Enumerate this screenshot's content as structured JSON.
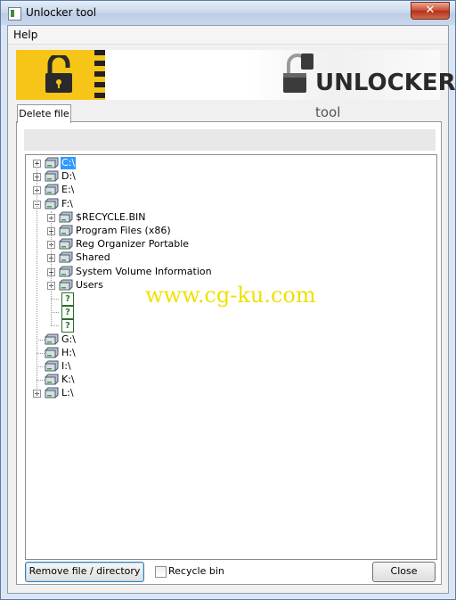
{
  "window": {
    "title": "Unlocker tool",
    "close_glyph": "✕"
  },
  "menu": {
    "help": "Help"
  },
  "banner": {
    "brand_big": "UNLOCKER",
    "brand_small": "tool"
  },
  "tab": {
    "label": "Delete file"
  },
  "tree": {
    "drives_top": [
      {
        "label": "C:\\",
        "selected": true,
        "expander": "+"
      },
      {
        "label": "D:\\",
        "expander": "+"
      },
      {
        "label": "E:\\",
        "expander": "+"
      },
      {
        "label": "F:\\",
        "expander": "−"
      }
    ],
    "folders": [
      {
        "label": "$RECYCLE.BIN",
        "expander": "+"
      },
      {
        "label": "Program Files (x86)",
        "expander": "+"
      },
      {
        "label": "Reg Organizer Portable",
        "expander": "+"
      },
      {
        "label": "Shared",
        "expander": "+"
      },
      {
        "label": "System Volume Information",
        "expander": "+"
      },
      {
        "label": "Users",
        "expander": "+"
      }
    ],
    "unknown_glyph": "?",
    "drives_bottom": [
      {
        "label": "G:\\"
      },
      {
        "label": "H:\\"
      },
      {
        "label": "I:\\"
      },
      {
        "label": "K:\\"
      },
      {
        "label": "L:\\",
        "expander": "+"
      }
    ]
  },
  "watermark": "www.cg-ku.com",
  "footer": {
    "remove_label": "Remove file / directory",
    "recycle_label": "Recycle bin",
    "recycle_checked": false,
    "close_label": "Close"
  },
  "colors": {
    "selection": "#3399ff",
    "banner_yellow": "#f7c518",
    "watermark": "#f0e000"
  }
}
